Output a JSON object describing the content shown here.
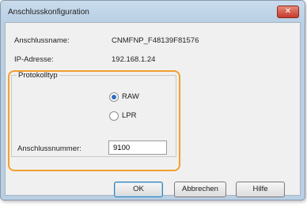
{
  "window": {
    "title": "Anschlusskonfiguration",
    "close_symbol": "✕"
  },
  "info": {
    "port_name_label": "Anschlussname:",
    "port_name_value": "CNMFNP_F48139F81576",
    "ip_label": "IP-Adresse:",
    "ip_value": "192.168.1.24"
  },
  "protocol": {
    "legend": "Protokolltyp",
    "options": [
      {
        "label": "RAW",
        "checked": true
      },
      {
        "label": "LPR",
        "checked": false
      }
    ]
  },
  "port_number": {
    "label": "Anschlussnummer:",
    "value": "9100"
  },
  "buttons": {
    "ok": "OK",
    "cancel": "Abbrechen",
    "help": "Hilfe"
  },
  "colors": {
    "highlight": "#f0a030",
    "accent": "#2e6fbf"
  }
}
